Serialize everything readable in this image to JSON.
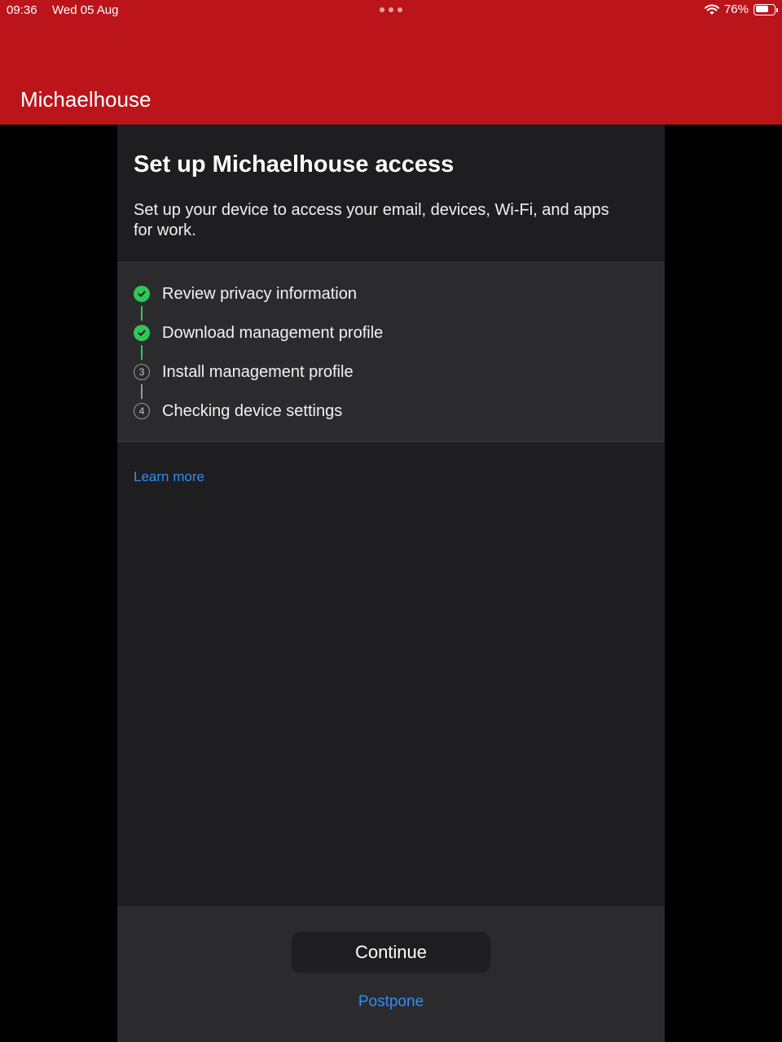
{
  "status_bar": {
    "time": "09:36",
    "date": "Wed 05 Aug",
    "battery_percent": "76%",
    "battery_level": 0.76
  },
  "header": {
    "title": "Michaelhouse"
  },
  "setup": {
    "title": "Set up Michaelhouse access",
    "description": "Set up your device to access your email, devices, Wi-Fi, and apps for work.",
    "steps": [
      {
        "label": "Review privacy information",
        "state": "done"
      },
      {
        "label": "Download management profile",
        "state": "done"
      },
      {
        "label": "Install management profile",
        "state": "pending",
        "number": "3"
      },
      {
        "label": "Checking device settings",
        "state": "pending",
        "number": "4"
      }
    ],
    "learn_more": "Learn more"
  },
  "footer": {
    "continue_label": "Continue",
    "postpone_label": "Postpone"
  },
  "colors": {
    "header_red": "#bb151b",
    "success_green": "#30c758",
    "link_blue": "#2f8ef6"
  }
}
